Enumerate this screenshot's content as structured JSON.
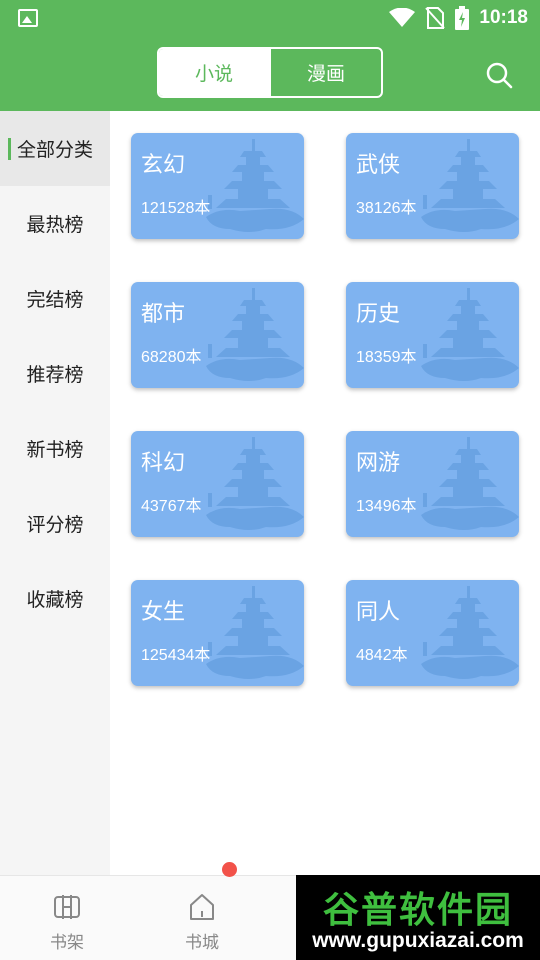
{
  "status_bar": {
    "time": "10:18",
    "icons": [
      "image-icon",
      "wifi-icon",
      "no-sim-icon",
      "battery-charging-icon"
    ]
  },
  "header": {
    "tabs": [
      {
        "label": "小说",
        "active": true
      },
      {
        "label": "漫画",
        "active": false
      }
    ],
    "search_icon": "search-icon"
  },
  "sidebar": {
    "items": [
      {
        "label": "全部分类",
        "active": true
      },
      {
        "label": "最热榜",
        "active": false
      },
      {
        "label": "完结榜",
        "active": false
      },
      {
        "label": "推荐榜",
        "active": false
      },
      {
        "label": "新书榜",
        "active": false
      },
      {
        "label": "评分榜",
        "active": false
      },
      {
        "label": "收藏榜",
        "active": false
      }
    ]
  },
  "categories": [
    {
      "name": "玄幻",
      "count": "121528本"
    },
    {
      "name": "武侠",
      "count": "38126本"
    },
    {
      "name": "都市",
      "count": "68280本"
    },
    {
      "name": "历史",
      "count": "18359本"
    },
    {
      "name": "科幻",
      "count": "43767本"
    },
    {
      "name": "网游",
      "count": "13496本"
    },
    {
      "name": "女生",
      "count": "125434本"
    },
    {
      "name": "同人",
      "count": "4842本"
    }
  ],
  "bottom_nav": {
    "items": [
      {
        "label": "书架",
        "icon": "bookshelf-icon"
      },
      {
        "label": "书城",
        "icon": "home-icon",
        "badge": true
      }
    ]
  },
  "watermark": {
    "title": "谷普软件园",
    "url": "www.gupuxiazai.com"
  },
  "colors": {
    "primary": "#5cb85c",
    "card": "#7fb3f0",
    "badge": "#f2524a"
  }
}
